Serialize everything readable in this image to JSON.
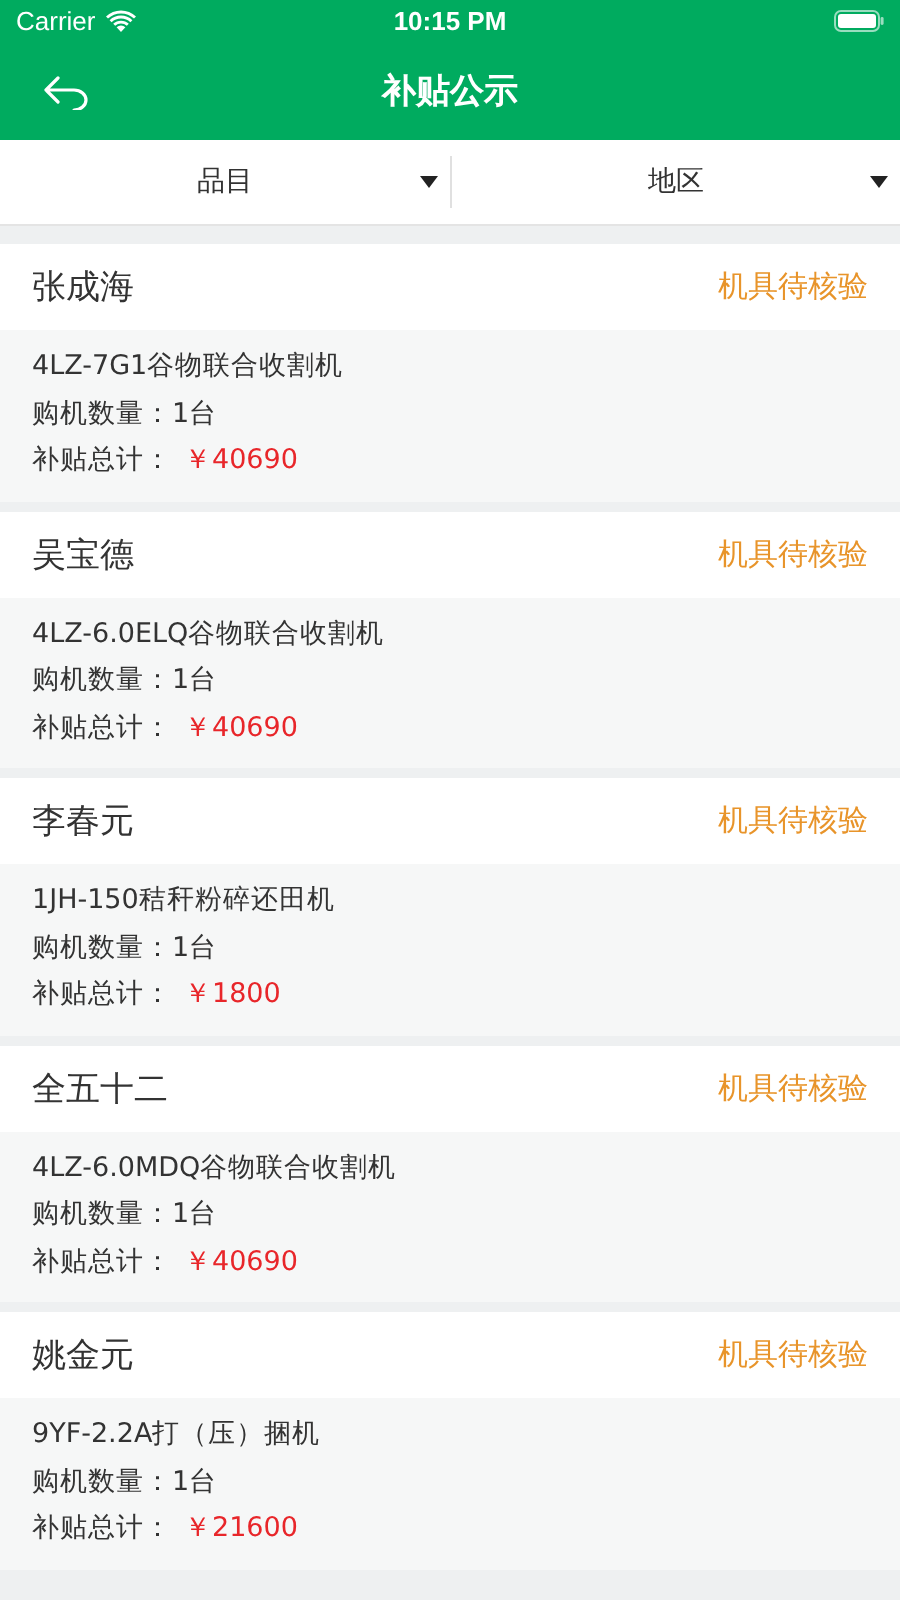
{
  "status_bar": {
    "carrier": "Carrier",
    "time": "10:15 PM"
  },
  "nav": {
    "title": "补贴公示"
  },
  "filters": [
    {
      "label": "品目"
    },
    {
      "label": "地区"
    }
  ],
  "records": [
    {
      "name": "张成海",
      "status": "机具待核验",
      "model": "4LZ-7G1谷物联合收割机",
      "quantity_label": "购机数量：",
      "quantity": "1台",
      "subsidy_label": "补贴总计：",
      "subsidy": "￥40690"
    },
    {
      "name": "吴宝德",
      "status": "机具待核验",
      "model": "4LZ-6.0ELQ谷物联合收割机",
      "quantity_label": "购机数量：",
      "quantity": "1台",
      "subsidy_label": "补贴总计：",
      "subsidy": "￥40690"
    },
    {
      "name": "李春元",
      "status": "机具待核验",
      "model": "1JH-150秸秆粉碎还田机",
      "quantity_label": "购机数量：",
      "quantity": "1台",
      "subsidy_label": "补贴总计：",
      "subsidy": "￥1800"
    },
    {
      "name": "全五十二",
      "status": "机具待核验",
      "model": "4LZ-6.0MDQ谷物联合收割机",
      "quantity_label": "购机数量：",
      "quantity": "1台",
      "subsidy_label": "补贴总计：",
      "subsidy": "￥40690"
    },
    {
      "name": "姚金元",
      "status": "机具待核验",
      "model": "9YF-2.2A打（压）捆机",
      "quantity_label": "购机数量：",
      "quantity": "1台",
      "subsidy_label": "补贴总计：",
      "subsidy": "￥21600"
    }
  ]
}
